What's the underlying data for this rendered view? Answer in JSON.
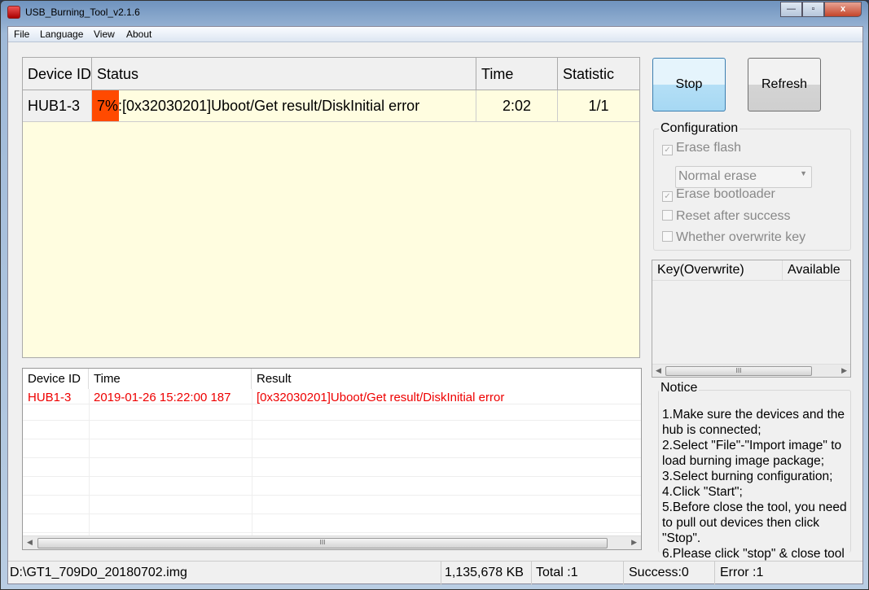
{
  "window": {
    "title": "USB_Burning_Tool_v2.1.6",
    "min": "—",
    "max": "▫",
    "close": "x"
  },
  "menu": [
    "File",
    "Language",
    "View",
    "About"
  ],
  "device_table": {
    "headers": [
      "Device ID",
      "Status",
      "Time",
      "Statistic"
    ],
    "rows": [
      {
        "device": "HUB1-3",
        "progress_label": "7%",
        "progress_percent": 7,
        "status": ":[0x32030201]Uboot/Get result/DiskInitial error",
        "time": "2:02",
        "statistic": "1/1"
      }
    ]
  },
  "log_table": {
    "headers": [
      "Device ID",
      "Time",
      "Result"
    ],
    "rows": [
      {
        "device": "HUB1-3",
        "time": "2019-01-26 15:22:00 187",
        "result": "[0x32030201]Uboot/Get result/DiskInitial error"
      }
    ],
    "scroll_grip": "III"
  },
  "buttons": {
    "stop": "Stop",
    "refresh": "Refresh"
  },
  "configuration": {
    "title": "Configuration",
    "erase_flash": {
      "label": "Erase flash",
      "checked": true
    },
    "erase_mode": "Normal erase",
    "erase_bootloader": {
      "label": "Erase bootloader",
      "checked": true
    },
    "reset_after_success": {
      "label": "Reset after success",
      "checked": false
    },
    "overwrite_key": {
      "label": "Whether overwrite key",
      "checked": false
    }
  },
  "key_list": {
    "headers": [
      "Key(Overwrite)",
      "Available"
    ],
    "scroll_grip": "III"
  },
  "notice": {
    "title": "Notice",
    "lines": [
      "1.Make sure the devices and the hub is connected;",
      "2.Select \"File\"-\"Import image\" to load burning image package;",
      "3.Select burning configuration;",
      "4.Click \"Start\";",
      "5.Before close the tool, you need to pull out devices then click \"Stop\".",
      "6.Please click \"stop\" & close tool"
    ]
  },
  "statusbar": {
    "file": "D:\\GT1_709D0_20180702.img",
    "size": "1,135,678 KB",
    "total": "Total :1",
    "success": "Success:0",
    "error": "Error :1"
  },
  "colors": {
    "progress": "#ff4a00",
    "grid_bg": "#fffde0",
    "error_text": "#e00000",
    "stop_button": "#b4dff6"
  }
}
